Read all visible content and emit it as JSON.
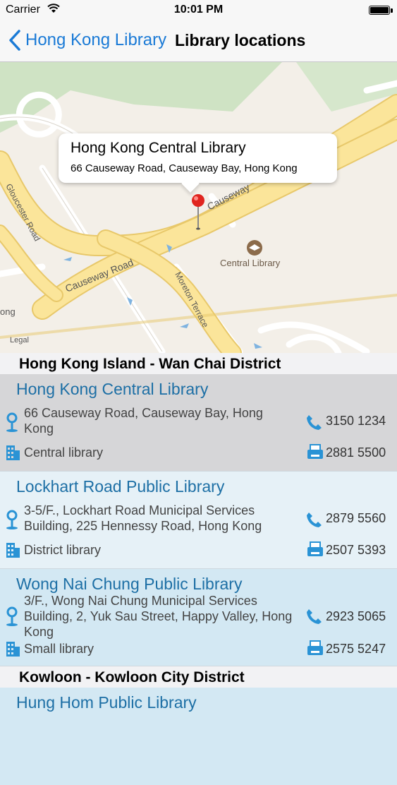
{
  "status_bar": {
    "carrier": "Carrier",
    "time": "10:01 PM"
  },
  "nav": {
    "back_label": "Hong Kong Library",
    "title": "Library locations"
  },
  "map": {
    "callout_title": "Hong Kong Central Library",
    "callout_subtitle": "66 Causeway Road, Causeway Bay, Hong Kong",
    "labels": {
      "causeway_road": "Causeway Road",
      "causeway_top": "Causeway",
      "gloucester": "Gloucester Road",
      "moreton": "Moreton Terrace",
      "central_library": "Central Library",
      "legal": "Legal",
      "edge": "ong"
    }
  },
  "sections": [
    {
      "header": "Hong Kong Island - Wan Chai District",
      "libraries": [
        {
          "name": "Hong Kong Central Library",
          "address": "66 Causeway Road, Causeway Bay, Hong Kong",
          "type": "Central library",
          "phone": "3150 1234",
          "fax": "2881 5500"
        },
        {
          "name": "Lockhart Road Public Library",
          "address": "3-5/F., Lockhart Road Municipal Services Building, 225 Hennessy Road, Hong Kong",
          "type": "District library",
          "phone": "2879 5560",
          "fax": "2507 5393"
        },
        {
          "name": "Wong Nai Chung Public Library",
          "address": "3/F., Wong Nai Chung Municipal Services Building, 2, Yuk Sau Street, Happy Valley, Hong Kong",
          "type": "Small library",
          "phone": "2923 5065",
          "fax": "2575 5247"
        }
      ]
    },
    {
      "header": "Kowloon - Kowloon City District",
      "libraries": [
        {
          "name": "Hung Hom Public Library"
        }
      ]
    }
  ],
  "colors": {
    "accent": "#1a7ad6",
    "row_selected": "#d6d6d8",
    "row_light": "#e6f1f7",
    "row_blue": "#d3e8f3",
    "link_text": "#1d6fa5",
    "icon_blue": "#2a93d5"
  }
}
